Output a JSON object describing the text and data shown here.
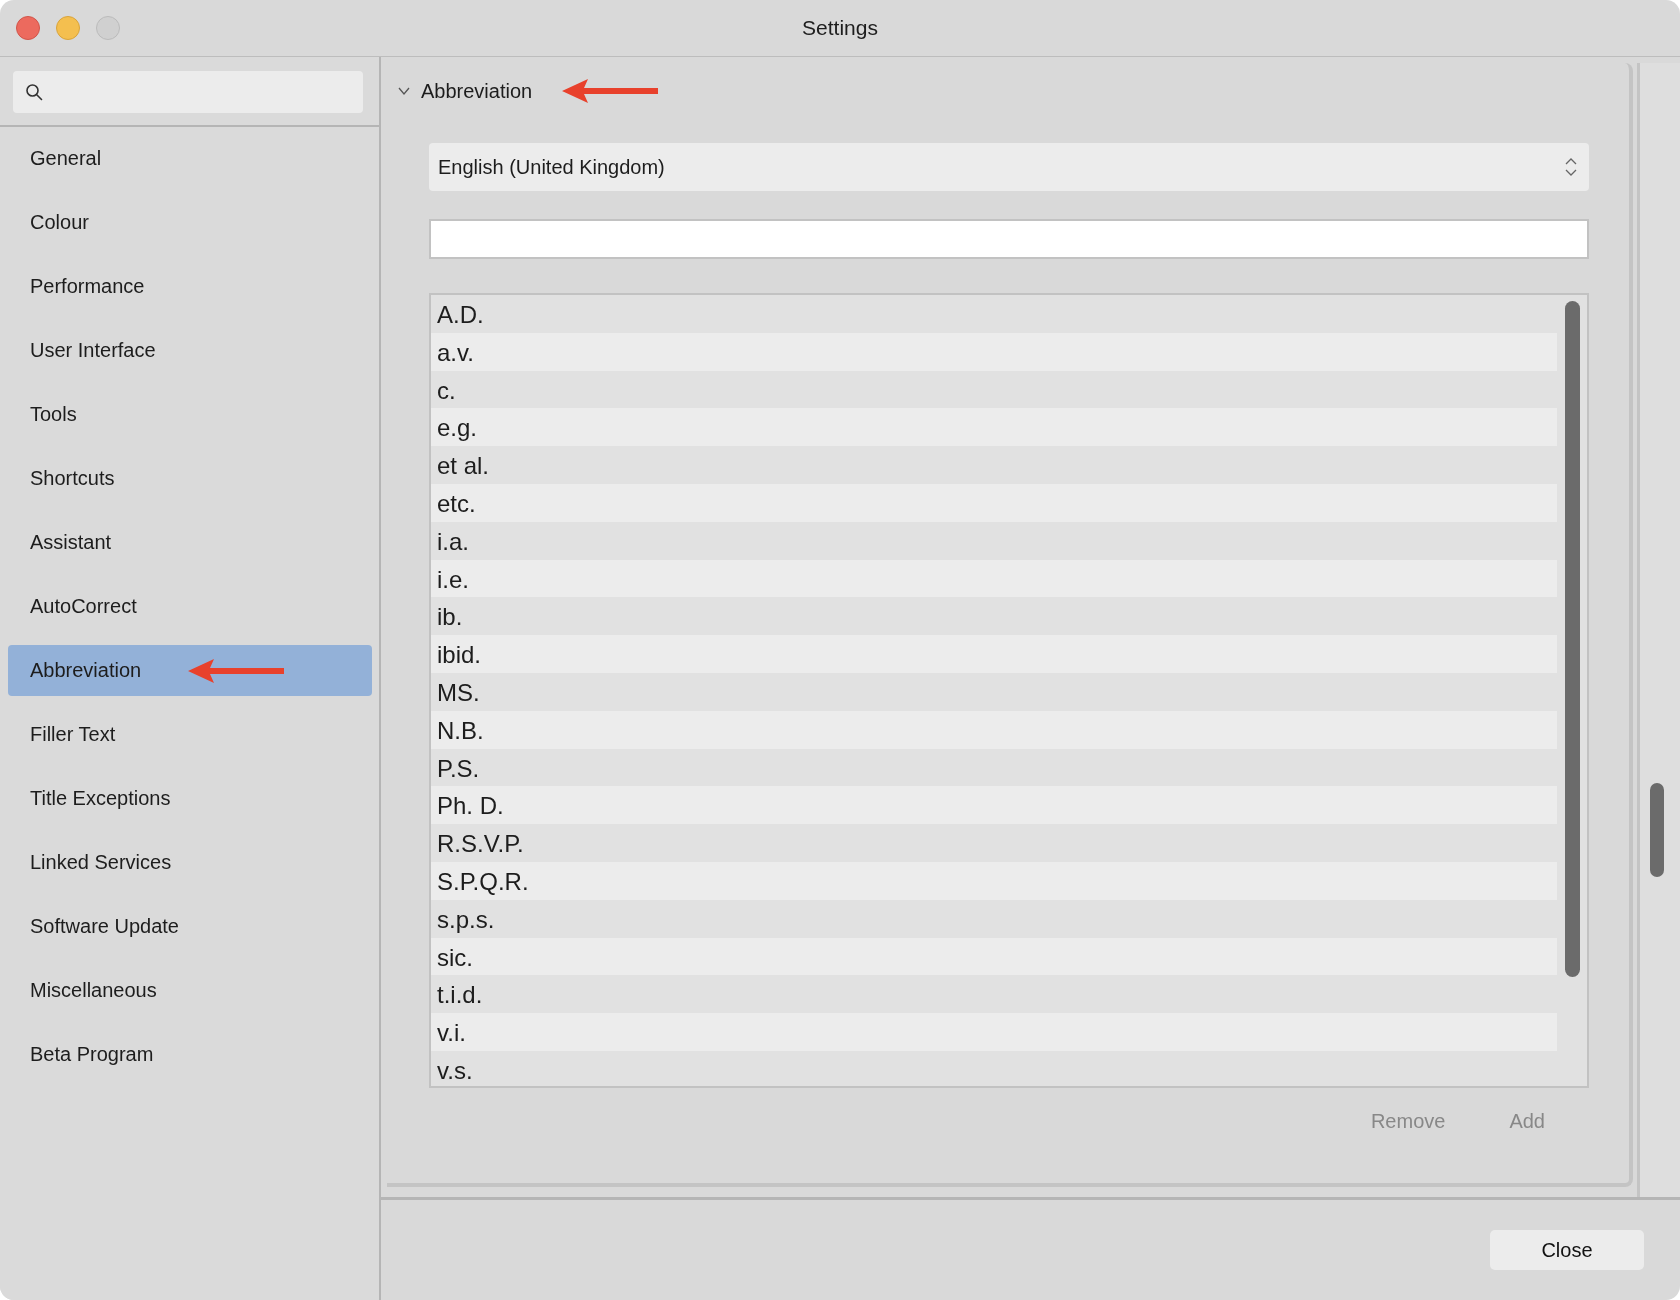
{
  "window": {
    "title": "Settings"
  },
  "sidebar": {
    "items": [
      {
        "label": "General",
        "selected": false
      },
      {
        "label": "Colour",
        "selected": false
      },
      {
        "label": "Performance",
        "selected": false
      },
      {
        "label": "User Interface",
        "selected": false
      },
      {
        "label": "Tools",
        "selected": false
      },
      {
        "label": "Shortcuts",
        "selected": false
      },
      {
        "label": "Assistant",
        "selected": false
      },
      {
        "label": "AutoCorrect",
        "selected": false
      },
      {
        "label": "Abbreviation",
        "selected": true
      },
      {
        "label": "Filler Text",
        "selected": false
      },
      {
        "label": "Title Exceptions",
        "selected": false
      },
      {
        "label": "Linked Services",
        "selected": false
      },
      {
        "label": "Software Update",
        "selected": false
      },
      {
        "label": "Miscellaneous",
        "selected": false
      },
      {
        "label": "Beta Program",
        "selected": false
      }
    ]
  },
  "section": {
    "title": "Abbreviation",
    "expanded": true,
    "language": "English (United Kingdom)",
    "entries": [
      "A.D.",
      "a.v.",
      "c.",
      "e.g.",
      "et al.",
      "etc.",
      "i.a.",
      "i.e.",
      "ib.",
      "ibid.",
      "MS.",
      "N.B.",
      "P.S.",
      "Ph. D.",
      "R.S.V.P.",
      "S.P.Q.R.",
      "s.p.s.",
      "sic.",
      "t.i.d.",
      "v.i.",
      "v.s."
    ],
    "buttons": [
      {
        "label": "Remove",
        "disabled": true
      },
      {
        "label": "Add",
        "disabled": true
      }
    ]
  },
  "footer": {
    "button": "Close"
  }
}
